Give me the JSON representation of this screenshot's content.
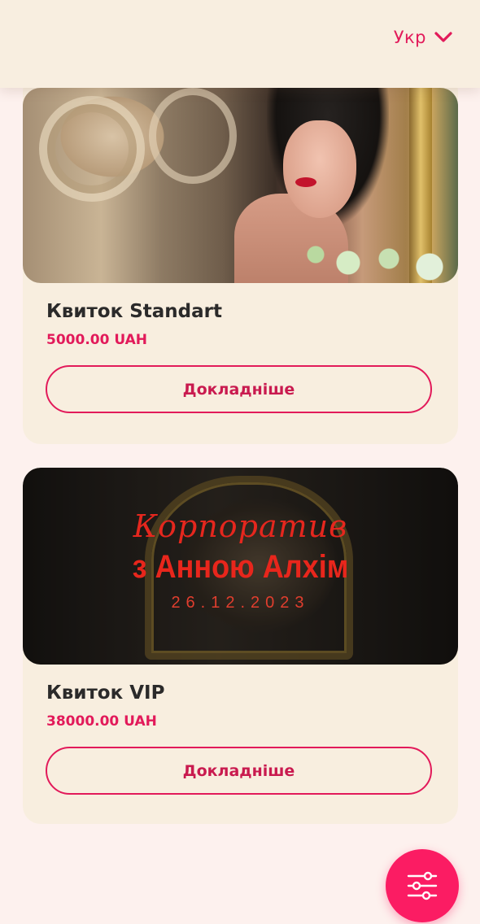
{
  "header": {
    "language_label": "Укр",
    "language_icon": "chevron-down-icon"
  },
  "accent_color": "#e21a5a",
  "tickets": [
    {
      "image": "photo-woman-mirror",
      "title": "Квиток Standart",
      "price": "5000.00 UAH",
      "button_label": "Докладніше"
    },
    {
      "image": "event-poster",
      "poster": {
        "script": "Корпоратив",
        "headline": "з Анною Алхім",
        "date": "26.12.2023"
      },
      "title": "Квиток VIP",
      "price": "38000.00 UAH",
      "button_label": "Докладніше"
    }
  ],
  "filter_button": {
    "icon": "filter-sliders-icon",
    "color": "#fb1c63"
  }
}
